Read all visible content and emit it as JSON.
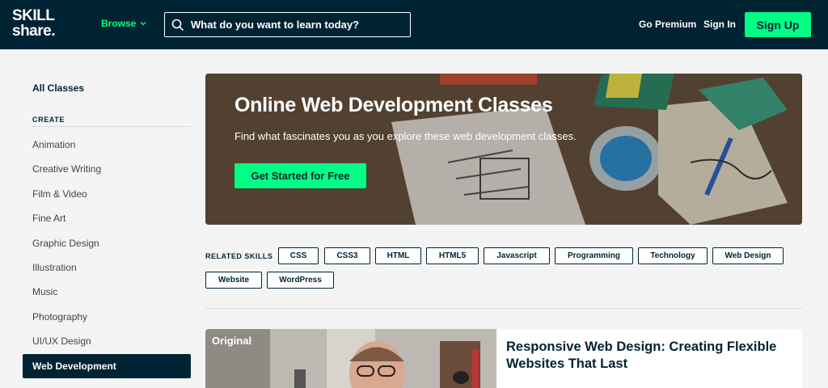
{
  "header": {
    "logo_line1": "SKILL",
    "logo_line2": "share.",
    "browse_label": "Browse",
    "search_placeholder": "What do you want to learn today?",
    "go_premium": "Go Premium",
    "sign_in": "Sign In",
    "sign_up": "Sign Up"
  },
  "sidebar": {
    "all_classes": "All Classes",
    "section_title": "CREATE",
    "items": [
      {
        "label": "Animation"
      },
      {
        "label": "Creative Writing"
      },
      {
        "label": "Film & Video"
      },
      {
        "label": "Fine Art"
      },
      {
        "label": "Graphic Design"
      },
      {
        "label": "Illustration"
      },
      {
        "label": "Music"
      },
      {
        "label": "Photography"
      },
      {
        "label": "UI/UX Design"
      },
      {
        "label": "Web Development",
        "active": true
      }
    ]
  },
  "hero": {
    "title": "Online Web Development Classes",
    "subtitle": "Find what fascinates you as you explore these web development classes.",
    "cta": "Get Started for Free"
  },
  "related": {
    "label": "RELATED SKILLS",
    "skills": [
      "CSS",
      "CSS3",
      "HTML",
      "HTML5",
      "Javascript",
      "Programming",
      "Technology",
      "Web Design",
      "Website",
      "WordPress"
    ]
  },
  "card": {
    "badge": "Original",
    "title": "Responsive Web Design: Creating Flexible Websites That Last"
  },
  "colors": {
    "navy": "#002333",
    "accent_green": "#00ff84",
    "background": "#f4f4f4"
  }
}
